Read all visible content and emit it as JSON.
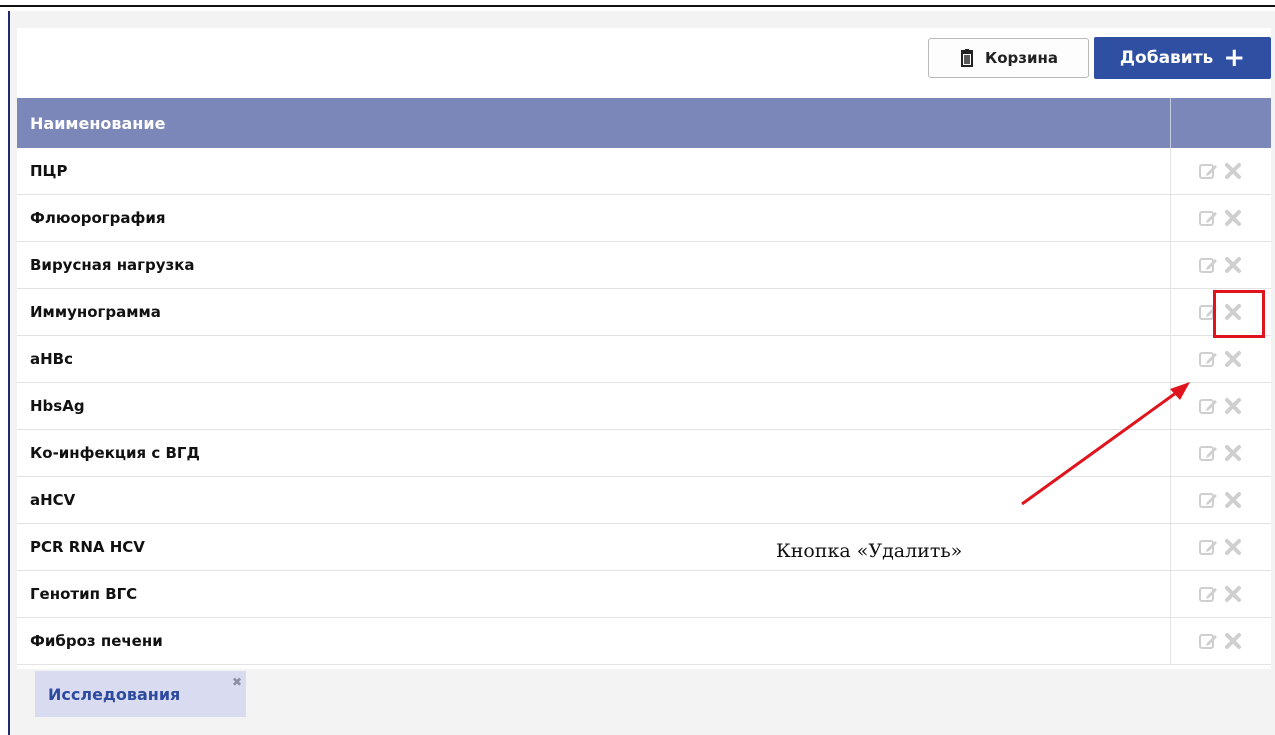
{
  "toolbar": {
    "basket_label": "Корзина",
    "add_label": "Добавить",
    "add_icon": "+"
  },
  "table": {
    "header": "Наименование",
    "rows": [
      {
        "name": "ПЦР"
      },
      {
        "name": "Флюорография"
      },
      {
        "name": "Вирусная нагрузка"
      },
      {
        "name": "Иммунограмма"
      },
      {
        "name": "aHBc"
      },
      {
        "name": "HbsAg"
      },
      {
        "name": "Ко-инфекция с ВГД"
      },
      {
        "name": "aHCV"
      },
      {
        "name": "PCR RNA HCV"
      },
      {
        "name": "Генотип ВГС"
      },
      {
        "name": "Фиброз печени"
      }
    ]
  },
  "tabs": {
    "active_label": "Исследования",
    "close_glyph": "✖"
  },
  "annotation": {
    "text": "Кнопка «Удалить»"
  },
  "colors": {
    "accent": "#2f4fa3",
    "header_bg": "#7b87b8",
    "tab_bg": "#d9dcf1",
    "highlight": "#e0141c"
  },
  "icons": [
    "trash-icon",
    "plus-icon",
    "edit-icon",
    "delete-icon",
    "close-icon",
    "arrow-icon"
  ]
}
